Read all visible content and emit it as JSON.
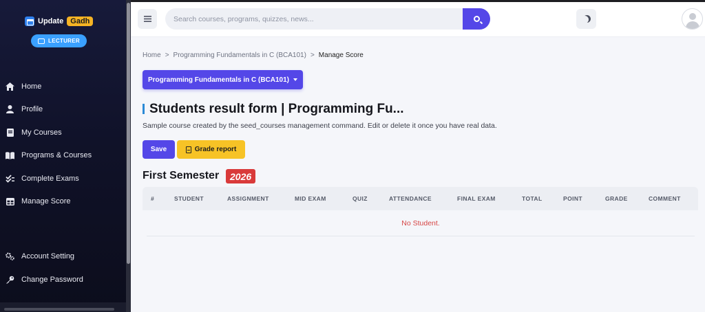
{
  "brand": {
    "name": "Update",
    "highlight": "Gadh",
    "role": "LECTURER"
  },
  "sidebar": {
    "items": [
      {
        "label": "Home",
        "icon": "home-icon"
      },
      {
        "label": "Profile",
        "icon": "user-icon"
      },
      {
        "label": "My Courses",
        "icon": "book-icon"
      },
      {
        "label": "Programs & Courses",
        "icon": "book-open-icon"
      },
      {
        "label": "Complete Exams",
        "icon": "check-double-icon"
      },
      {
        "label": "Manage Score",
        "icon": "table-icon"
      },
      {
        "label": "Account Setting",
        "icon": "gears-icon"
      },
      {
        "label": "Change Password",
        "icon": "key-icon"
      }
    ]
  },
  "search": {
    "placeholder": "Search courses, programs, quizzes, news..."
  },
  "breadcrumb": {
    "home": "Home",
    "sep": ">",
    "course": "Programming Fundamentals in C (BCA101)",
    "current": "Manage Score"
  },
  "course_select": {
    "label": "Programming Fundamentals in C (BCA101)"
  },
  "page": {
    "title": "Students result form | Programming Fu...",
    "description": "Sample course created by the seed_courses management command. Edit or delete it once you have real data.",
    "save_label": "Save",
    "grade_report_label": "Grade report",
    "semester": "First Semester",
    "year": "2026"
  },
  "table": {
    "columns": [
      "#",
      "STUDENT",
      "ASSIGNMENT",
      "MID EXAM",
      "QUIZ",
      "ATTENDANCE",
      "FINAL EXAM",
      "TOTAL",
      "POINT",
      "GRADE",
      "COMMENT"
    ],
    "empty_message": "No Student."
  },
  "colors": {
    "primary": "#5447e8",
    "warning": "#f7c326",
    "danger": "#d93a3a",
    "sidebar_bg": "#101229",
    "role_badge": "#3aa0ff"
  }
}
